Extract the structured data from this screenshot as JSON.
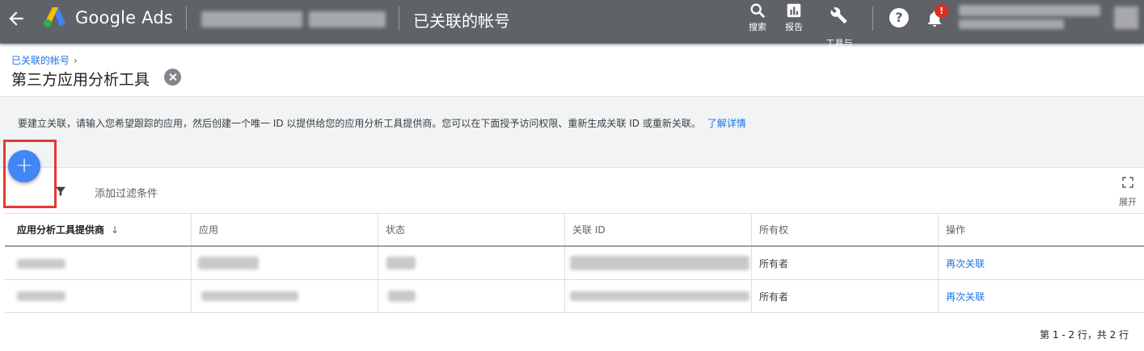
{
  "header": {
    "brand": "Google Ads",
    "page_title": "已关联的帐号",
    "tools": [
      {
        "label": "搜索",
        "icon": "search-icon"
      },
      {
        "label": "报告",
        "icon": "reports-icon"
      },
      {
        "label": "工具与\n设置",
        "icon": "wrench-icon"
      }
    ],
    "notification_badge": "!",
    "help_glyph": "?"
  },
  "breadcrumb": {
    "label": "已关联的帐号"
  },
  "page": {
    "title": "第三方应用分析工具"
  },
  "info": {
    "text": "要建立关联，请输入您希望跟踪的应用，然后创建一个唯一 ID 以提供给您的应用分析工具提供商。您可以在下面授予访问权限、重新生成关联 ID 或重新关联。",
    "link": "了解详情"
  },
  "fab": {
    "glyph": "+"
  },
  "filter": {
    "label": "添加过滤条件"
  },
  "expand": {
    "label": "展开"
  },
  "table": {
    "columns": [
      "应用分析工具提供商",
      "应用",
      "状态",
      "关联 ID",
      "所有权",
      "操作"
    ],
    "sort_indicator": "↓",
    "rows": [
      {
        "ownership": "所有者",
        "action": "再次关联"
      },
      {
        "ownership": "所有者",
        "action": "再次关联"
      }
    ]
  },
  "pagination": {
    "text": "第 1 - 2 行，共 2 行"
  },
  "colors": {
    "topbar": "#5f6368",
    "accent": "#1a73e8",
    "fab": "#4285f4",
    "highlight": "#e53935"
  }
}
